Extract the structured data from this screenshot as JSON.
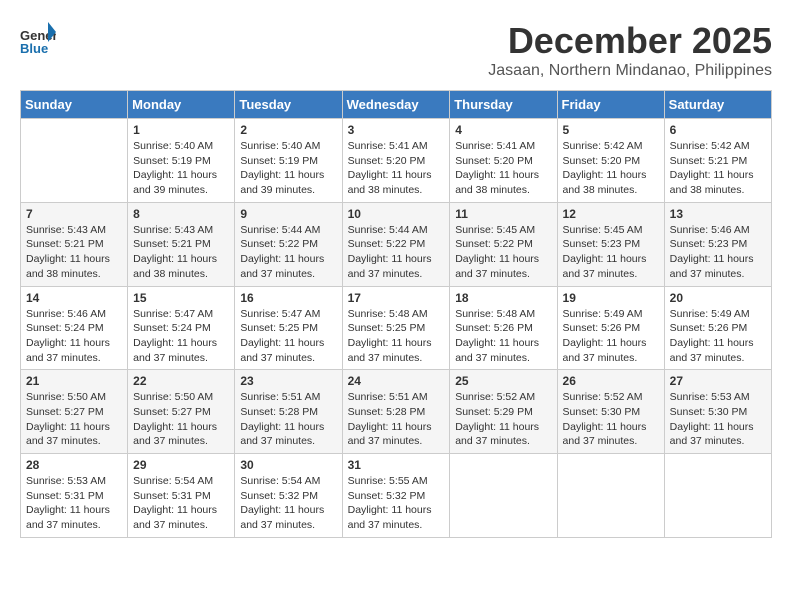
{
  "logo": {
    "general": "General",
    "blue": "Blue"
  },
  "header": {
    "month": "December 2025",
    "location": "Jasaan, Northern Mindanao, Philippines"
  },
  "weekdays": [
    "Sunday",
    "Monday",
    "Tuesday",
    "Wednesday",
    "Thursday",
    "Friday",
    "Saturday"
  ],
  "weeks": [
    [
      {
        "day": "",
        "info": ""
      },
      {
        "day": "1",
        "info": "Sunrise: 5:40 AM\nSunset: 5:19 PM\nDaylight: 11 hours\nand 39 minutes."
      },
      {
        "day": "2",
        "info": "Sunrise: 5:40 AM\nSunset: 5:19 PM\nDaylight: 11 hours\nand 39 minutes."
      },
      {
        "day": "3",
        "info": "Sunrise: 5:41 AM\nSunset: 5:20 PM\nDaylight: 11 hours\nand 38 minutes."
      },
      {
        "day": "4",
        "info": "Sunrise: 5:41 AM\nSunset: 5:20 PM\nDaylight: 11 hours\nand 38 minutes."
      },
      {
        "day": "5",
        "info": "Sunrise: 5:42 AM\nSunset: 5:20 PM\nDaylight: 11 hours\nand 38 minutes."
      },
      {
        "day": "6",
        "info": "Sunrise: 5:42 AM\nSunset: 5:21 PM\nDaylight: 11 hours\nand 38 minutes."
      }
    ],
    [
      {
        "day": "7",
        "info": "Sunrise: 5:43 AM\nSunset: 5:21 PM\nDaylight: 11 hours\nand 38 minutes."
      },
      {
        "day": "8",
        "info": "Sunrise: 5:43 AM\nSunset: 5:21 PM\nDaylight: 11 hours\nand 38 minutes."
      },
      {
        "day": "9",
        "info": "Sunrise: 5:44 AM\nSunset: 5:22 PM\nDaylight: 11 hours\nand 37 minutes."
      },
      {
        "day": "10",
        "info": "Sunrise: 5:44 AM\nSunset: 5:22 PM\nDaylight: 11 hours\nand 37 minutes."
      },
      {
        "day": "11",
        "info": "Sunrise: 5:45 AM\nSunset: 5:22 PM\nDaylight: 11 hours\nand 37 minutes."
      },
      {
        "day": "12",
        "info": "Sunrise: 5:45 AM\nSunset: 5:23 PM\nDaylight: 11 hours\nand 37 minutes."
      },
      {
        "day": "13",
        "info": "Sunrise: 5:46 AM\nSunset: 5:23 PM\nDaylight: 11 hours\nand 37 minutes."
      }
    ],
    [
      {
        "day": "14",
        "info": "Sunrise: 5:46 AM\nSunset: 5:24 PM\nDaylight: 11 hours\nand 37 minutes."
      },
      {
        "day": "15",
        "info": "Sunrise: 5:47 AM\nSunset: 5:24 PM\nDaylight: 11 hours\nand 37 minutes."
      },
      {
        "day": "16",
        "info": "Sunrise: 5:47 AM\nSunset: 5:25 PM\nDaylight: 11 hours\nand 37 minutes."
      },
      {
        "day": "17",
        "info": "Sunrise: 5:48 AM\nSunset: 5:25 PM\nDaylight: 11 hours\nand 37 minutes."
      },
      {
        "day": "18",
        "info": "Sunrise: 5:48 AM\nSunset: 5:26 PM\nDaylight: 11 hours\nand 37 minutes."
      },
      {
        "day": "19",
        "info": "Sunrise: 5:49 AM\nSunset: 5:26 PM\nDaylight: 11 hours\nand 37 minutes."
      },
      {
        "day": "20",
        "info": "Sunrise: 5:49 AM\nSunset: 5:26 PM\nDaylight: 11 hours\nand 37 minutes."
      }
    ],
    [
      {
        "day": "21",
        "info": "Sunrise: 5:50 AM\nSunset: 5:27 PM\nDaylight: 11 hours\nand 37 minutes."
      },
      {
        "day": "22",
        "info": "Sunrise: 5:50 AM\nSunset: 5:27 PM\nDaylight: 11 hours\nand 37 minutes."
      },
      {
        "day": "23",
        "info": "Sunrise: 5:51 AM\nSunset: 5:28 PM\nDaylight: 11 hours\nand 37 minutes."
      },
      {
        "day": "24",
        "info": "Sunrise: 5:51 AM\nSunset: 5:28 PM\nDaylight: 11 hours\nand 37 minutes."
      },
      {
        "day": "25",
        "info": "Sunrise: 5:52 AM\nSunset: 5:29 PM\nDaylight: 11 hours\nand 37 minutes."
      },
      {
        "day": "26",
        "info": "Sunrise: 5:52 AM\nSunset: 5:30 PM\nDaylight: 11 hours\nand 37 minutes."
      },
      {
        "day": "27",
        "info": "Sunrise: 5:53 AM\nSunset: 5:30 PM\nDaylight: 11 hours\nand 37 minutes."
      }
    ],
    [
      {
        "day": "28",
        "info": "Sunrise: 5:53 AM\nSunset: 5:31 PM\nDaylight: 11 hours\nand 37 minutes."
      },
      {
        "day": "29",
        "info": "Sunrise: 5:54 AM\nSunset: 5:31 PM\nDaylight: 11 hours\nand 37 minutes."
      },
      {
        "day": "30",
        "info": "Sunrise: 5:54 AM\nSunset: 5:32 PM\nDaylight: 11 hours\nand 37 minutes."
      },
      {
        "day": "31",
        "info": "Sunrise: 5:55 AM\nSunset: 5:32 PM\nDaylight: 11 hours\nand 37 minutes."
      },
      {
        "day": "",
        "info": ""
      },
      {
        "day": "",
        "info": ""
      },
      {
        "day": "",
        "info": ""
      }
    ]
  ]
}
